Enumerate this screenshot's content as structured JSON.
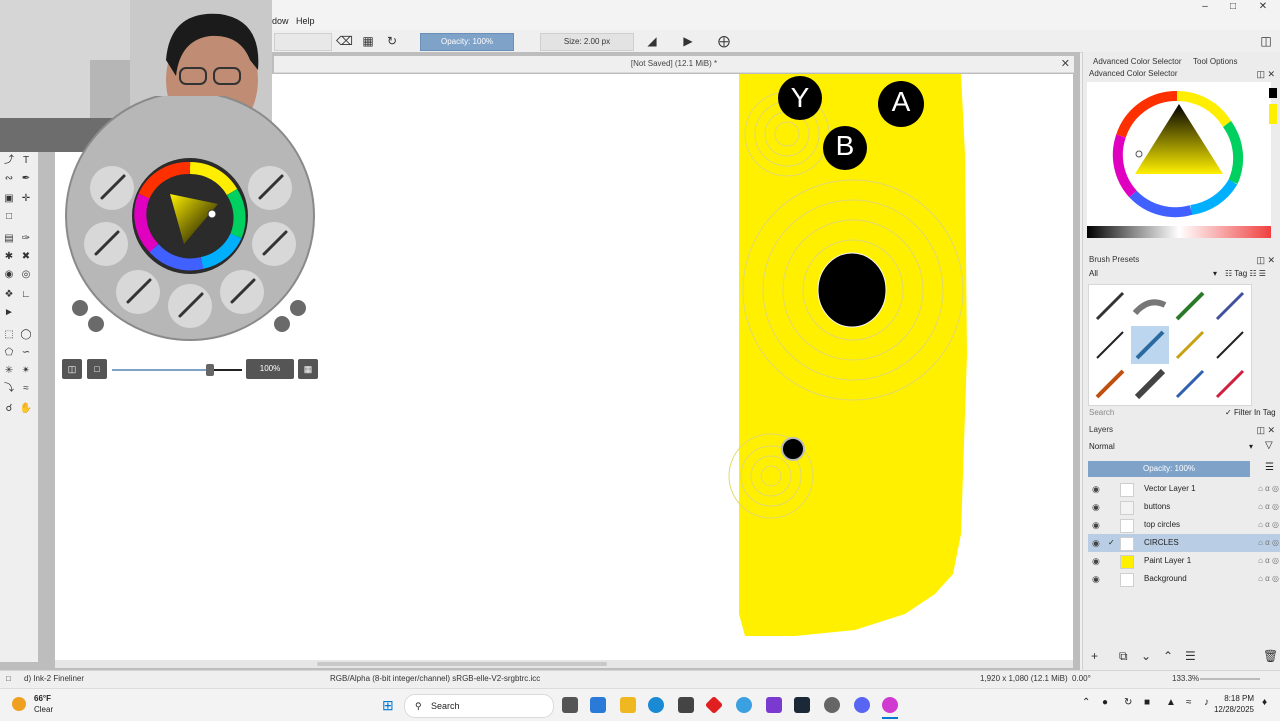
{
  "window": {
    "minimize": "–",
    "maximize": "□",
    "close": "✕"
  },
  "menu": {
    "items": [
      "dow",
      "Help"
    ]
  },
  "toolbar": {
    "opacity": "Opacity: 100%",
    "size": "Size: 2.00 px"
  },
  "document": {
    "title": "[Not Saved]  (12.1 MiB) *",
    "close": "✕"
  },
  "canvas": {
    "button_labels": [
      "Y",
      "A",
      "B"
    ],
    "fill_color": "#fff000"
  },
  "palette": {
    "zoom_label": "100%",
    "slider_value": 0.75
  },
  "docker": {
    "tabs": [
      "Advanced Color Selector",
      "Tool Options"
    ],
    "color_selector_title": "Advanced Color Selector",
    "brush_presets_title": "Brush Presets",
    "brush_filter": "All",
    "tag_label": "Tag",
    "search_placeholder": "Search",
    "filter_in_tag": "Filter In Tag",
    "layers_title": "Layers",
    "blend_mode": "Normal",
    "layer_opacity": "Opacity:  100%",
    "layers": [
      {
        "name": "Vector Layer 1",
        "selected": false
      },
      {
        "name": "buttons",
        "selected": false
      },
      {
        "name": "top circles",
        "selected": false
      },
      {
        "name": "CIRCLES",
        "selected": true
      },
      {
        "name": "Paint Layer 1",
        "selected": false
      },
      {
        "name": "Background",
        "selected": false
      }
    ]
  },
  "status": {
    "brush": "d) Ink-2 Fineliner",
    "color_space": "RGB/Alpha (8-bit integer/channel)  sRGB-elle-V2-srgbtrc.icc",
    "dimensions": "1,920 x 1,080 (12.1 MiB)",
    "rotation": "0.00°",
    "zoom": "133.3%"
  },
  "taskbar": {
    "weather_temp": "66°F",
    "weather_desc": "Clear",
    "search": "Search",
    "time": "8:18 PM",
    "date": "12/28/2025"
  },
  "colors": {
    "accent": "#7fa2c9",
    "yellow": "#fff000"
  }
}
